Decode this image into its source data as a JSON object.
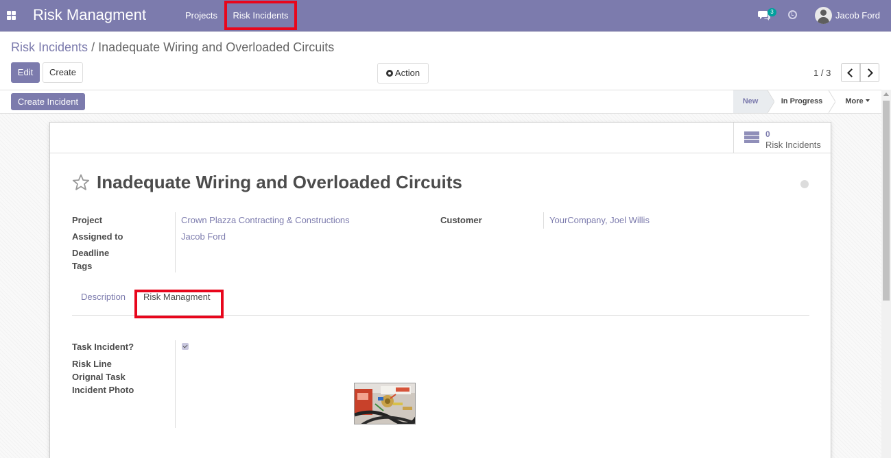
{
  "navbar": {
    "brand": "Risk Managment",
    "menu": [
      {
        "label": "Projects"
      },
      {
        "label": "Risk Incidents",
        "highlighted": true
      }
    ],
    "chat_count": "3",
    "user": "Jacob Ford",
    "color": "#7c7bad"
  },
  "breadcrumb": {
    "parent": "Risk Incidents",
    "separator": "/",
    "current": "Inadequate Wiring and Overloaded Circuits"
  },
  "toolbar": {
    "edit_label": "Edit",
    "create_label": "Create",
    "action_label": "Action",
    "pager": "1 / 3"
  },
  "statusbar": {
    "create_incident_label": "Create Incident",
    "stages": [
      {
        "label": "New",
        "active": true
      },
      {
        "label": "In Progress",
        "active": false
      },
      {
        "label": "More",
        "dropdown": true
      }
    ]
  },
  "smart_button": {
    "count": "0",
    "label": "Risk Incidents"
  },
  "record": {
    "title": "Inadequate Wiring and Overloaded Circuits",
    "fields_left": [
      {
        "label": "Project",
        "value": "Crown Plazza Contracting & Constructions"
      },
      {
        "label": "Assigned to",
        "value": "Jacob Ford"
      },
      {
        "label": "Deadline",
        "value": ""
      },
      {
        "label": "Tags",
        "value": ""
      }
    ],
    "fields_right": [
      {
        "label": "Customer",
        "value": "YourCompany, Joel Willis"
      }
    ]
  },
  "tabs": [
    {
      "label": "Description",
      "active": false
    },
    {
      "label": "Risk Managment",
      "active": true
    }
  ],
  "risk_tab": {
    "fields": [
      {
        "label": "Task Incident?",
        "checked": true
      },
      {
        "label": "Risk Line"
      },
      {
        "label": "Orignal Task"
      },
      {
        "label": "Incident Photo"
      }
    ]
  },
  "highlight_color": "#e8061c"
}
